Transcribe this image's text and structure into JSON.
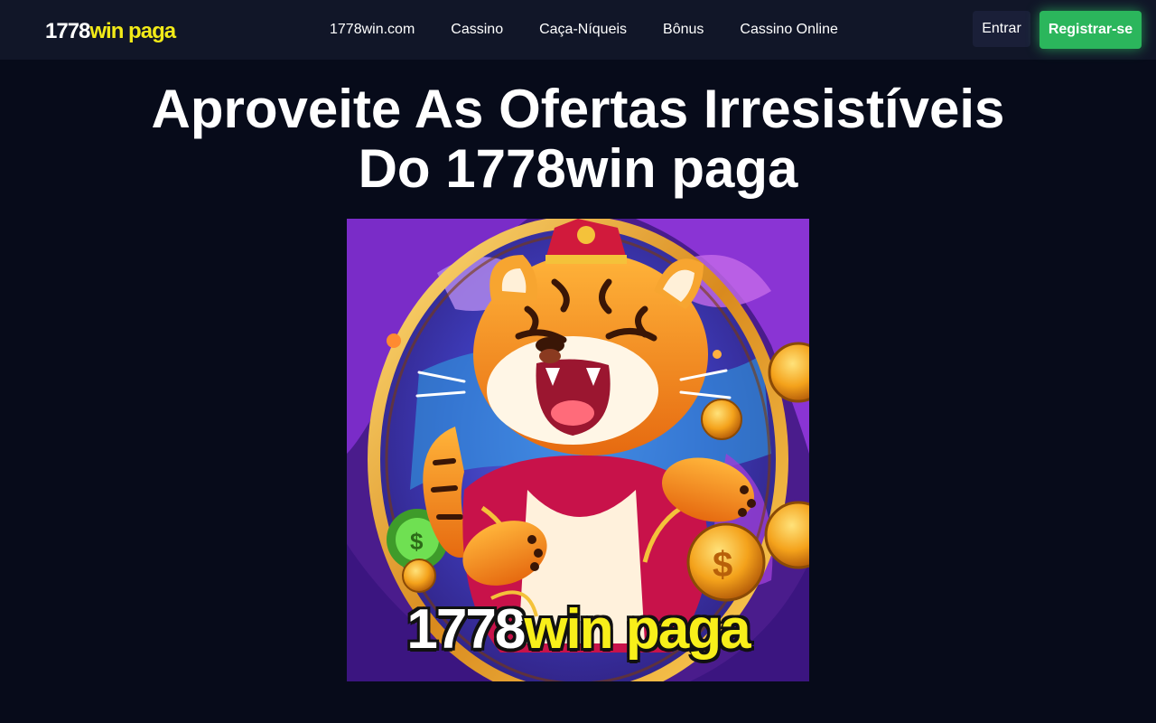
{
  "header": {
    "logo_part1": "1778",
    "logo_part2": "win paga",
    "nav": [
      {
        "label": "1778win.com"
      },
      {
        "label": "Cassino"
      },
      {
        "label": "Caça-Níqueis"
      },
      {
        "label": "Bônus"
      },
      {
        "label": "Cassino Online"
      }
    ],
    "login_label": "Entrar",
    "register_label": "Registrar-se"
  },
  "hero": {
    "title_line1": "Aproveite As Ofertas Irresistíveis",
    "title_line2": "Do 1778win paga"
  },
  "banner": {
    "caption_part1": "1778",
    "caption_part2": "win paga",
    "icon": "tiger-mascot-illustration"
  },
  "colors": {
    "background": "#070b1a",
    "header": "#111628",
    "accent_yellow": "#f2ea18",
    "register_green": "#2bb65c",
    "login_bg": "#1a1f38"
  }
}
